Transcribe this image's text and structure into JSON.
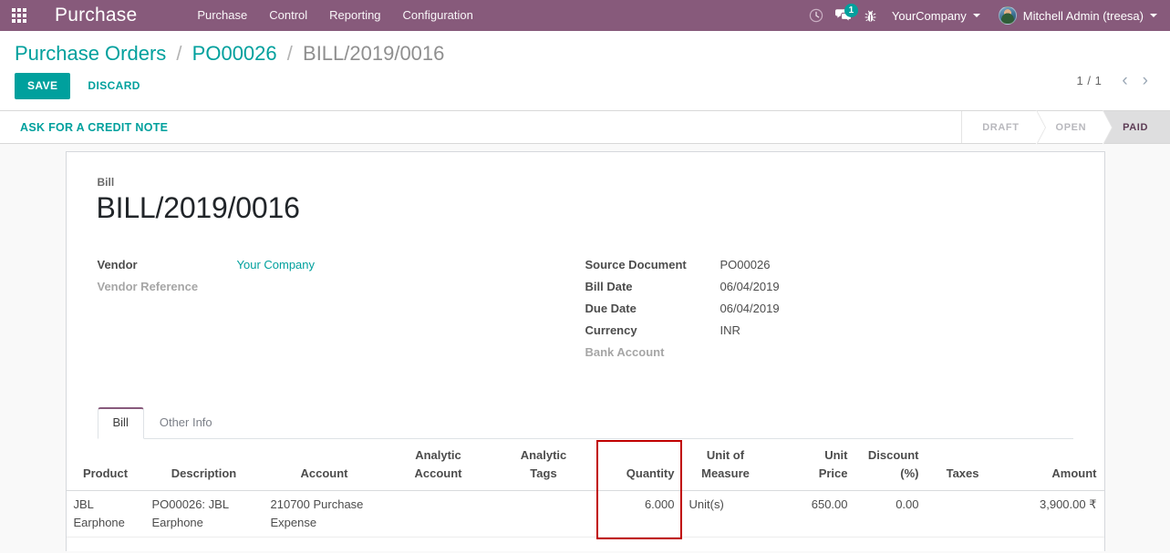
{
  "navbar": {
    "apps_icon": "apps-grid-icon",
    "brand": "Purchase",
    "menus": [
      "Purchase",
      "Control",
      "Reporting",
      "Configuration"
    ],
    "activity_icon": "clock-activity-icon",
    "messaging_icon": "chat-bubble-icon",
    "messaging_count": "1",
    "debug_icon": "bug-icon",
    "company": "YourCompany",
    "user": "Mitchell Admin (treesa)",
    "avatar": "user-avatar",
    "accent_teal": "#00a09d",
    "brand_purple": "#875a7b"
  },
  "control_panel": {
    "breadcrumb": {
      "root": "Purchase Orders",
      "parent": "PO00026",
      "current": "BILL/2019/0016",
      "separator": "/"
    },
    "save_label": "SAVE",
    "discard_label": "DISCARD",
    "pager": {
      "position": "1 / 1",
      "prev_icon": "chevron-left-icon",
      "next_icon": "chevron-right-icon"
    }
  },
  "statusbar": {
    "credit_note_label": "ASK FOR A CREDIT NOTE",
    "stages": [
      {
        "label": "DRAFT",
        "state": "done"
      },
      {
        "label": "OPEN",
        "state": "done"
      },
      {
        "label": "PAID",
        "state": "current"
      }
    ]
  },
  "form": {
    "title_label": "Bill",
    "title": "BILL/2019/0016",
    "left_fields": [
      {
        "label": "Vendor",
        "value": "Your Company",
        "style": "link",
        "muted": false
      },
      {
        "label": "Vendor Reference",
        "value": "",
        "style": "text",
        "muted": true
      }
    ],
    "right_fields": [
      {
        "label": "Source Document",
        "value": "PO00026",
        "style": "text",
        "muted": false
      },
      {
        "label": "Bill Date",
        "value": "06/04/2019",
        "style": "text",
        "muted": false
      },
      {
        "label": "Due Date",
        "value": "06/04/2019",
        "style": "text",
        "muted": false
      },
      {
        "label": "Currency",
        "value": "INR",
        "style": "text",
        "muted": false
      },
      {
        "label": "Bank Account",
        "value": "",
        "style": "text",
        "muted": true
      }
    ],
    "tabs": [
      {
        "label": "Bill",
        "active": true
      },
      {
        "label": "Other Info",
        "active": false
      }
    ]
  },
  "lines_table": {
    "columns": [
      {
        "label": "Product",
        "align": "left"
      },
      {
        "label": "Description",
        "align": "left"
      },
      {
        "label": "Account",
        "align": "left"
      },
      {
        "label": "Analytic Account",
        "align": "left"
      },
      {
        "label": "Analytic Tags",
        "align": "left"
      },
      {
        "label": "Quantity",
        "align": "right"
      },
      {
        "label": "Unit of Measure",
        "align": "left"
      },
      {
        "label": "Unit Price",
        "align": "right"
      },
      {
        "label": "Discount (%)",
        "align": "right"
      },
      {
        "label": "Taxes",
        "align": "right"
      },
      {
        "label": "Amount",
        "align": "right"
      }
    ],
    "rows": [
      {
        "product": "JBL Earphone",
        "description": "PO00026: JBL Earphone",
        "account": "210700 Purchase Expense",
        "analytic_account": "",
        "analytic_tags": "",
        "quantity": "6.000",
        "uom": "Unit(s)",
        "unit_price": "650.00",
        "discount": "0.00",
        "taxes": "",
        "amount": "3,900.00 ₹"
      }
    ],
    "highlight": {
      "name": "quantity-column-highlight",
      "color": "#c00000"
    }
  }
}
